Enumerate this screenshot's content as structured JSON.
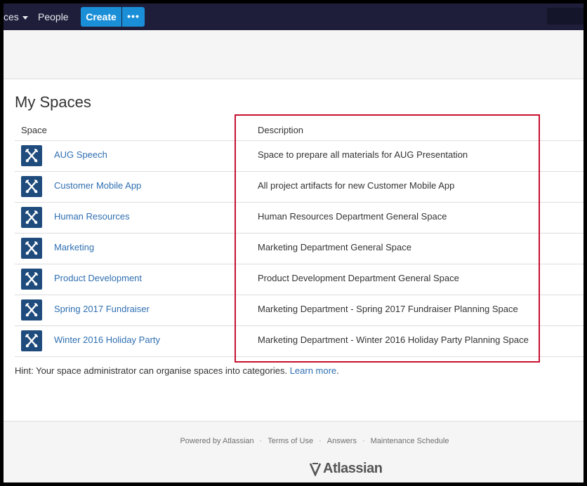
{
  "nav": {
    "spaces_label": "ces",
    "people_label": "People",
    "create_label": "Create",
    "more_label": "•••"
  },
  "page": {
    "title": "My Spaces"
  },
  "table": {
    "headers": {
      "space": "Space",
      "description": "Description"
    },
    "rows": [
      {
        "name": "AUG Speech",
        "description": "Space to prepare all materials for AUG Presentation"
      },
      {
        "name": "Customer Mobile App",
        "description": "All project artifacts for new Customer Mobile App"
      },
      {
        "name": "Human Resources",
        "description": "Human Resources Department General Space"
      },
      {
        "name": "Marketing",
        "description": "Marketing Department General Space"
      },
      {
        "name": "Product Development",
        "description": "Product Development Department General Space"
      },
      {
        "name": "Spring 2017 Fundraiser",
        "description": "Marketing Department - Spring 2017 Fundraiser Planning Space"
      },
      {
        "name": "Winter 2016 Holiday Party",
        "description": "Marketing Department - Winter 2016 Holiday Party Planning Space"
      }
    ]
  },
  "hint": {
    "text": "Hint: Your space administrator can organise spaces into categories.",
    "link": "Learn more",
    "suffix": "."
  },
  "footer": {
    "links": [
      "Powered by Atlassian",
      "Terms of Use",
      "Answers",
      "Maintenance Schedule"
    ],
    "logo_text": "Atlassian"
  },
  "colors": {
    "nav_bg": "#1e1e3a",
    "create_button": "#1a8fd8",
    "link": "#2f6fb1",
    "space_icon_bg": "#1f4c7d",
    "highlight": "#c8102e"
  },
  "icons": {
    "space_icon": "tools-icon",
    "more_icon": "ellipsis-icon",
    "caret": "caret-down-icon"
  }
}
